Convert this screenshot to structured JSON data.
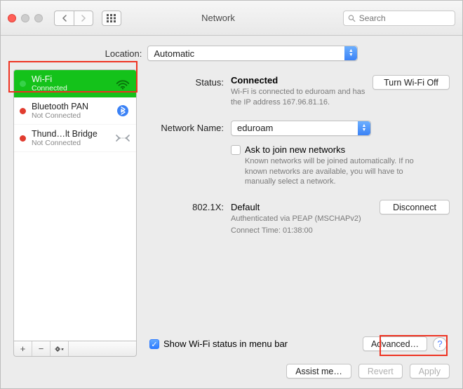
{
  "window": {
    "title": "Network"
  },
  "toolbar": {
    "search_placeholder": "Search"
  },
  "location": {
    "label": "Location:",
    "value": "Automatic"
  },
  "sidebar": {
    "items": [
      {
        "name": "Wi-Fi",
        "sub": "Connected",
        "status": "green",
        "icon": "wifi",
        "selected": true
      },
      {
        "name": "Bluetooth PAN",
        "sub": "Not Connected",
        "status": "red",
        "icon": "bluetooth",
        "selected": false
      },
      {
        "name": "Thund…lt Bridge",
        "sub": "Not Connected",
        "status": "red",
        "icon": "thunderbolt",
        "selected": false
      }
    ],
    "buttons": {
      "add": "+",
      "remove": "−"
    }
  },
  "detail": {
    "status_label": "Status:",
    "status_value": "Connected",
    "wifi_toggle": "Turn Wi-Fi Off",
    "status_desc": "Wi-Fi is connected to eduroam and has the IP address 167.96.81.16.",
    "network_label": "Network Name:",
    "network_value": "eduroam",
    "ask_join": "Ask to join new networks",
    "ask_join_desc": "Known networks will be joined automatically. If no known networks are available, you will have to manually select a network.",
    "dot1x_label": "802.1X:",
    "dot1x_value": "Default",
    "disconnect": "Disconnect",
    "dot1x_desc1": "Authenticated via PEAP (MSCHAPv2)",
    "dot1x_desc2": "Connect Time: 01:38:00",
    "show_menubar": "Show Wi-Fi status in menu bar",
    "advanced": "Advanced…"
  },
  "footer": {
    "assist": "Assist me…",
    "revert": "Revert",
    "apply": "Apply"
  }
}
